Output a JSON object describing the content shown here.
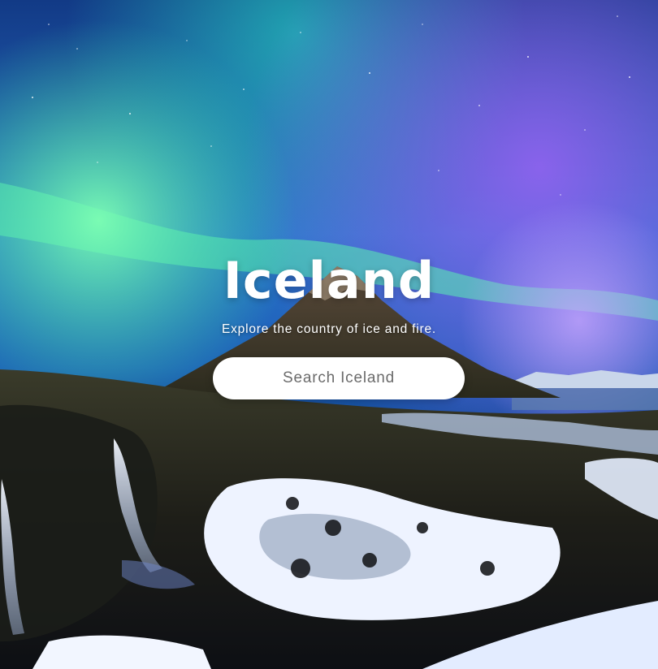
{
  "hero": {
    "title": "Iceland",
    "subtitle": "Explore the country of ice and fire.",
    "search": {
      "placeholder": "Search Iceland",
      "value": ""
    },
    "background": {
      "description_icon": "aurora-mountain-landscape"
    }
  },
  "colors": {
    "text": "#ffffff",
    "search_background": "#ffffff",
    "search_placeholder": "#6b6b6b",
    "sky_top": "#0c1a4a",
    "aurora_green": "#36e3a8",
    "aurora_purple": "#9a5cf0"
  }
}
